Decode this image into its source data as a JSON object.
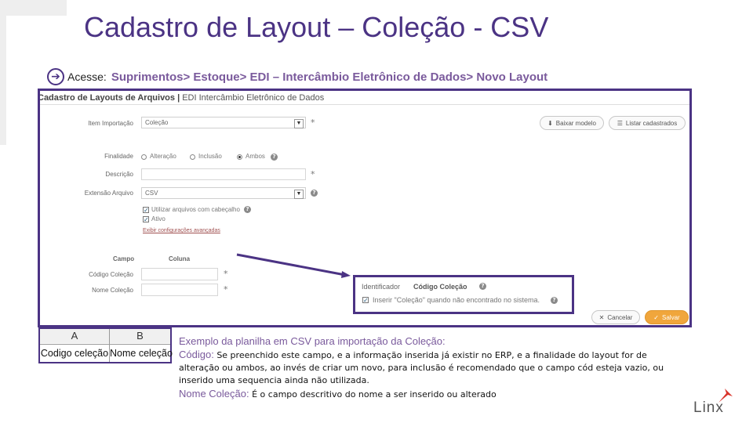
{
  "slide": {
    "title": "Cadastro de Layout – Coleção - CSV",
    "path_prefix": "Acesse:",
    "path": "Suprimentos> Estoque> EDI – Intercâmbio Eletrônico de Dados> Novo Layout"
  },
  "form": {
    "header_title": "Cadastro de Layouts de Arquivos |",
    "header_sub": "EDI Intercâmbio Eletrônico de Dados",
    "item_importacao_label": "Item Importação",
    "item_importacao_value": "Coleção",
    "btn_baixar": "Baixar modelo",
    "btn_listar": "Listar cadastrados",
    "finalidade_label": "Finalidade",
    "finalidade_options": [
      "Alteração",
      "Inclusão",
      "Ambos"
    ],
    "finalidade_selected": "Ambos",
    "descricao_label": "Descrição",
    "extensao_label": "Extensão Arquivo",
    "extensao_value": "CSV",
    "chk_cabecalho": "Utilizar arquivos com cabeçalho",
    "chk_ativo": "Ativo",
    "link_avancadas": "Exibir configurações avançadas",
    "col_campo": "Campo",
    "col_coluna": "Coluna",
    "codigo_colecao_label": "Código Coleção",
    "nome_colecao_label": "Nome Coleção",
    "btn_cancelar": "Cancelar",
    "btn_salvar": "Salvar",
    "required_mark": "*"
  },
  "inset": {
    "identificador_label": "Identificador",
    "codigo_colecao": "Código Coleção",
    "chk_inserir": "Inserir \"Coleção\" quando não encontrado no sistema."
  },
  "sheet": {
    "col_a": "A",
    "col_b": "B",
    "cell_a": "Codigo celeção",
    "cell_b": "Nome celeção"
  },
  "notes": {
    "title": "Exemplo da planilha em CSV para importação da Coleção:",
    "codigo_key": "Código:",
    "codigo_line1": "Se preenchido este campo, e a informação inserida já existir no ERP, e a finalidade do layout for de",
    "codigo_line2": "alteração ou ambos, ao invés de criar um novo, para inclusão é recomendado que o campo cód esteja vazio, ou",
    "codigo_line3": "inserido uma sequencia ainda não utilizada.",
    "nome_key": "Nome Coleção:",
    "nome_text": "É o campo descritivo do nome a ser inserido ou alterado"
  },
  "logo": {
    "text": "Linx"
  },
  "colors": {
    "brand": "#4b3384",
    "accent": "#7a5a9c",
    "save": "#f0a63c",
    "logo_red": "#d9342b"
  }
}
